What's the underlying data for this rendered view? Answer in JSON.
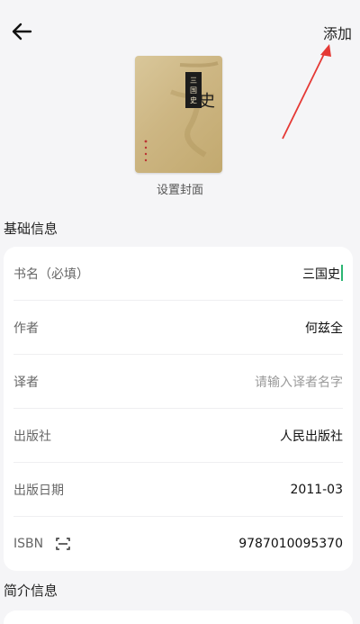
{
  "header": {
    "back_icon": "arrow-left-icon",
    "add_label": "添加"
  },
  "cover": {
    "set_cover_label": "设置封面",
    "cover_text": "三国史"
  },
  "basic_info": {
    "title": "基础信息",
    "fields": [
      {
        "label": "书名（必填）",
        "value": "三国史",
        "placeholder": ""
      },
      {
        "label": "作者",
        "value": "何兹全",
        "placeholder": ""
      },
      {
        "label": "译者",
        "value": "",
        "placeholder": "请输入译者名字"
      },
      {
        "label": "出版社",
        "value": "人民出版社",
        "placeholder": ""
      },
      {
        "label": "出版日期",
        "value": "2011-03",
        "placeholder": ""
      },
      {
        "label": "ISBN",
        "value": "9787010095370",
        "placeholder": "",
        "icon": "scan-icon"
      }
    ]
  },
  "intro_info": {
    "title": "简介信息"
  },
  "colors": {
    "annotation_arrow": "#e53935",
    "cursor": "#2bb673"
  }
}
